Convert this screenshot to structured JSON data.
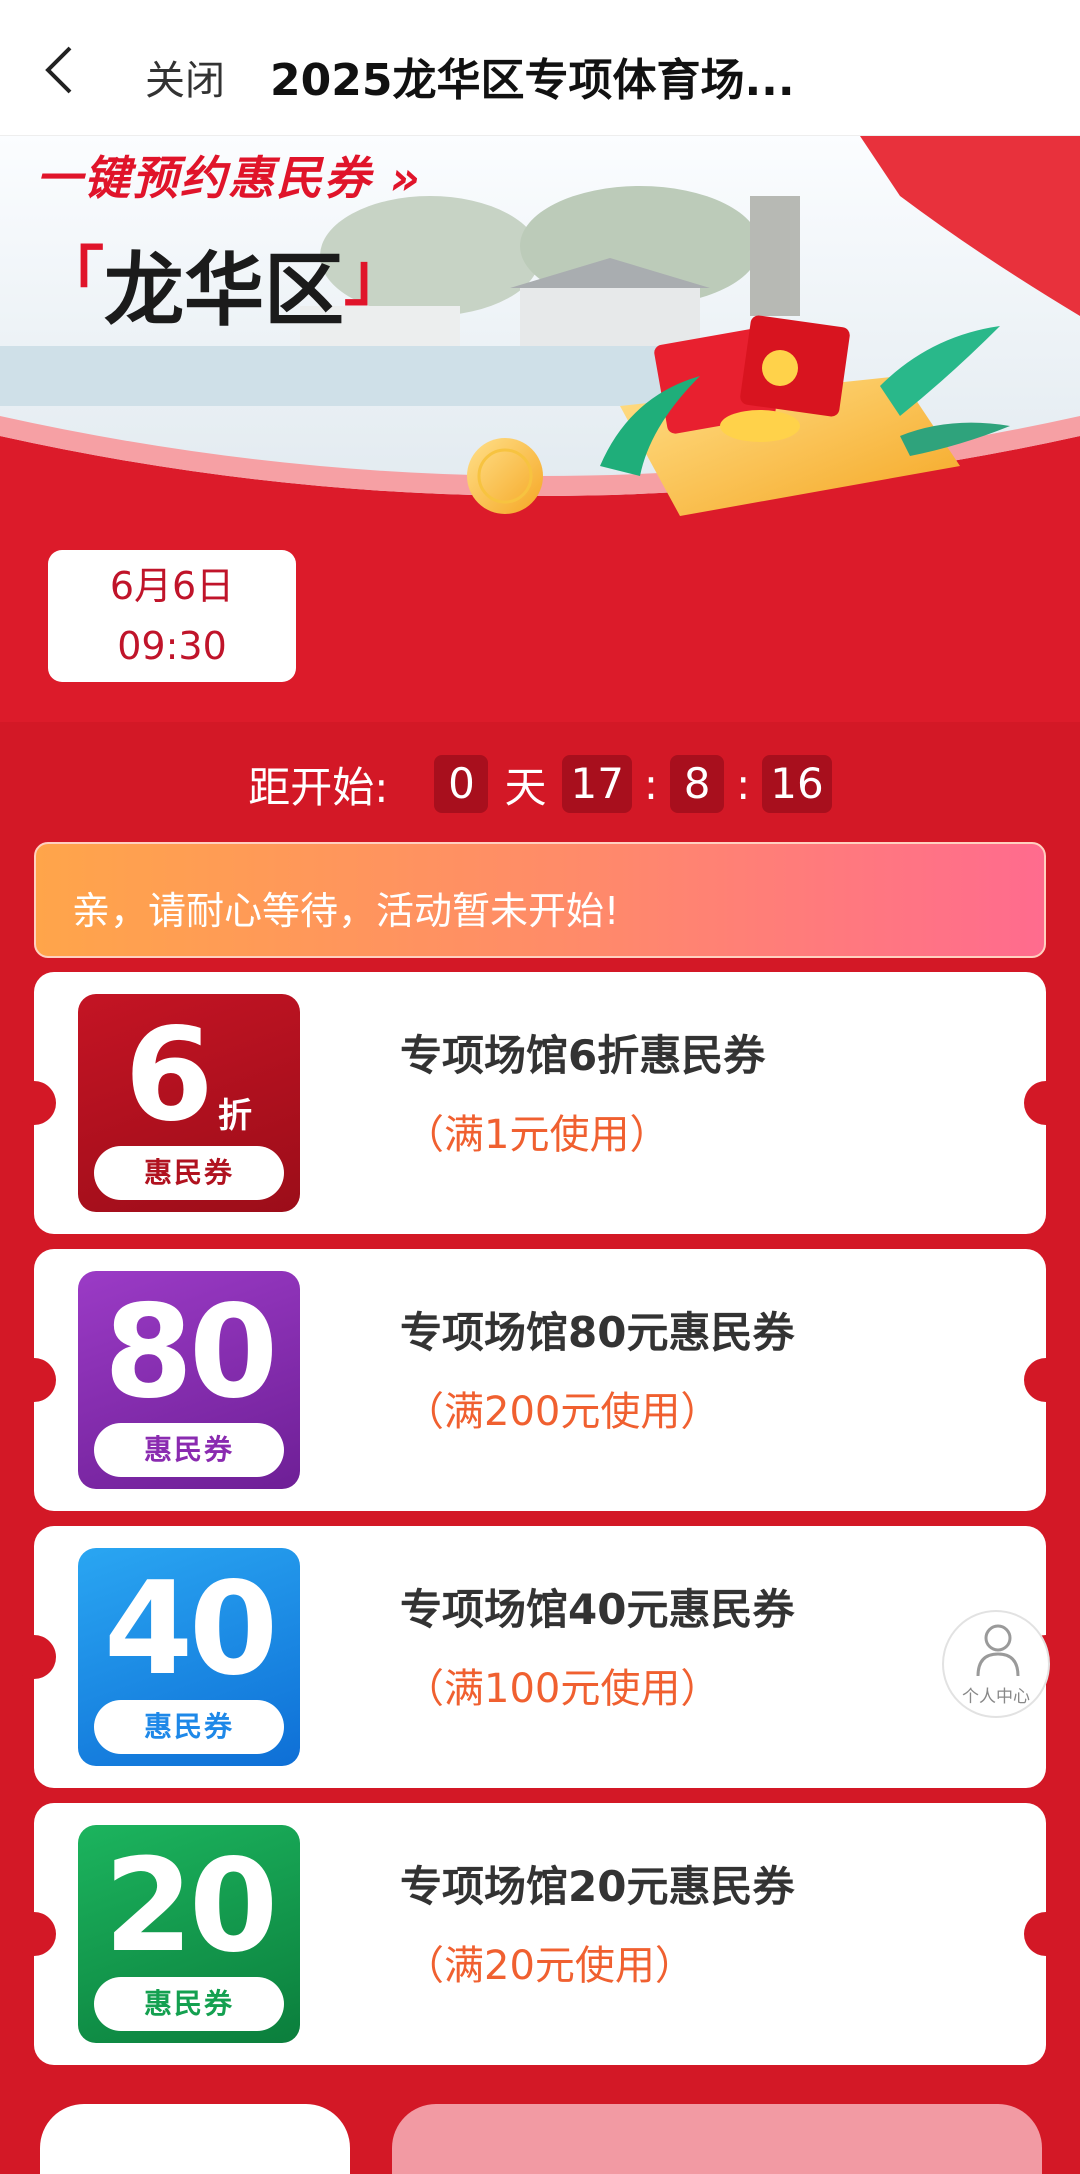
{
  "nav": {
    "close_label": "关闭",
    "title": "2025龙华区专项体育场..."
  },
  "hero": {
    "headline": "一键预约惠民券 »",
    "region_open": "「",
    "region": "龙华区",
    "region_close": "」"
  },
  "event_date": {
    "date": "6月6日",
    "time": "09:30"
  },
  "countdown": {
    "label": "距开始:",
    "days": "0",
    "day_unit": "天",
    "hours": "17",
    "minutes": "8",
    "seconds": "16",
    "separator": ":"
  },
  "notice": {
    "text": "亲，请耐心等待，活动暂未开始!"
  },
  "coupons": [
    {
      "badge_value": "6",
      "badge_unit": "折",
      "badge_label": "惠民券",
      "title": "专项场馆6折惠民券",
      "condition": "（满1元使用）",
      "color": "#b0121f"
    },
    {
      "badge_value": "80",
      "badge_unit": "",
      "badge_label": "惠民券",
      "title": "专项场馆80元惠民券",
      "condition": "（满200元使用）",
      "color": "#8a2bb0"
    },
    {
      "badge_value": "40",
      "badge_unit": "",
      "badge_label": "惠民券",
      "title": "专项场馆40元惠民券",
      "condition": "（满100元使用）",
      "color": "#1e88e8"
    },
    {
      "badge_value": "20",
      "badge_unit": "",
      "badge_label": "惠民券",
      "title": "专项场馆20元惠民券",
      "condition": "（满20元使用）",
      "color": "#14a050"
    }
  ],
  "profile": {
    "label": "个人中心",
    "icon": "person-icon"
  }
}
